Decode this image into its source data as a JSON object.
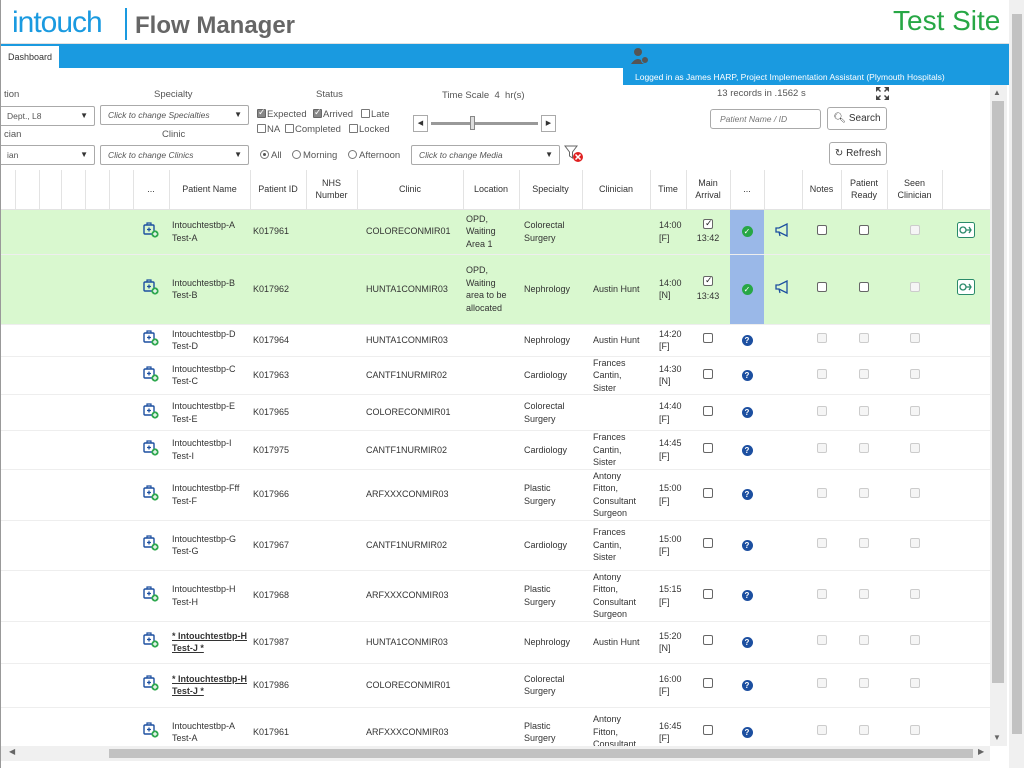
{
  "header": {
    "logo_intouch": "intouch",
    "logo_product": "Flow Manager",
    "site_label": "Test Site"
  },
  "nav": {
    "tab_dashboard": "Dashboard",
    "logged_in": "Logged in as James HARP, Project Implementation Assistant (Plymouth Hospitals)"
  },
  "filters": {
    "location_label": "tion",
    "location_value": "Dept., L8",
    "specialty_label": "Specialty",
    "specialty_placeholder": "Click to change Specialties",
    "clinician_label": "cian",
    "clinician_value": "ian",
    "clinic_label": "Clinic",
    "clinic_placeholder": "Click to change Clinics",
    "status_label": "Status",
    "status": {
      "expected": "Expected",
      "arrived": "Arrived",
      "late": "Late",
      "na": "NA",
      "completed": "Completed",
      "locked": "Locked"
    },
    "period": {
      "all": "All",
      "morning": "Morning",
      "afternoon": "Afternoon"
    },
    "timescale_label": "Time Scale",
    "timescale_value": "4",
    "timescale_unit": "hr(s)",
    "media_placeholder": "Click to change Media",
    "records_info": "13 records in .1562 s",
    "patient_placeholder": "Patient Name / ID",
    "search_label": "Search",
    "refresh_label": "Refresh"
  },
  "table": {
    "columns": {
      "dots1": "...",
      "patient_name": "Patient Name",
      "patient_id": "Patient ID",
      "nhs_number": "NHS Number",
      "clinic": "Clinic",
      "location": "Location",
      "specialty": "Specialty",
      "clinician": "Clinician",
      "time": "Time",
      "main_arrival": "Main Arrival",
      "dots2": "...",
      "notes": "Notes",
      "patient_ready": "Patient Ready",
      "seen_clinician": "Seen Clinician"
    },
    "rows": [
      {
        "name": "Intouchtestbp-A Test-A",
        "id": "K017961",
        "clinic": "COLORECONMIR01",
        "location": "OPD, Waiting Area 1",
        "specialty": "Colorectal Surgery",
        "clinician": "",
        "time": "14:00 [F]",
        "arrival_time": "13:42"
      },
      {
        "name": "Intouchtestbp-B Test-B",
        "id": "K017962",
        "clinic": "HUNTA1CONMIR03",
        "location": "OPD, Waiting area to be allocated",
        "specialty": "Nephrology",
        "clinician": "Austin Hunt",
        "time": "14:00 [N]",
        "arrival_time": "13:43"
      },
      {
        "name": "Intouchtestbp-D Test-D",
        "id": "K017964",
        "clinic": "HUNTA1CONMIR03",
        "location": "",
        "specialty": "Nephrology",
        "clinician": "Austin Hunt",
        "time": "14:20 [F]",
        "arrival_time": ""
      },
      {
        "name": "Intouchtestbp-C Test-C",
        "id": "K017963",
        "clinic": "CANTF1NURMIR02",
        "location": "",
        "specialty": "Cardiology",
        "clinician": "Frances Cantin, Sister",
        "time": "14:30 [N]",
        "arrival_time": ""
      },
      {
        "name": "Intouchtestbp-E Test-E",
        "id": "K017965",
        "clinic": "COLORECONMIR01",
        "location": "",
        "specialty": "Colorectal Surgery",
        "clinician": "",
        "time": "14:40 [F]",
        "arrival_time": ""
      },
      {
        "name": "Intouchtestbp-I Test-I",
        "id": "K017975",
        "clinic": "CANTF1NURMIR02",
        "location": "",
        "specialty": "Cardiology",
        "clinician": "Frances Cantin, Sister",
        "time": "14:45 [F]",
        "arrival_time": ""
      },
      {
        "name": "Intouchtestbp-Fff Test-F",
        "id": "K017966",
        "clinic": "ARFXXXCONMIR03",
        "location": "",
        "specialty": "Plastic Surgery",
        "clinician": "Antony Fitton, Consultant Surgeon",
        "time": "15:00 [F]",
        "arrival_time": ""
      },
      {
        "name": "Intouchtestbp-G Test-G",
        "id": "K017967",
        "clinic": "CANTF1NURMIR02",
        "location": "",
        "specialty": "Cardiology",
        "clinician": "Frances Cantin, Sister",
        "time": "15:00 [F]",
        "arrival_time": ""
      },
      {
        "name": "Intouchtestbp-H Test-H",
        "id": "K017968",
        "clinic": "ARFXXXCONMIR03",
        "location": "",
        "specialty": "Plastic Surgery",
        "clinician": "Antony Fitton, Consultant Surgeon",
        "time": "15:15 [F]",
        "arrival_time": ""
      },
      {
        "name": "* Intouchtestbp-H Test-J *",
        "id": "K017987",
        "clinic": "HUNTA1CONMIR03",
        "location": "",
        "specialty": "Nephrology",
        "clinician": "Austin Hunt",
        "time": "15:20 [N]",
        "arrival_time": ""
      },
      {
        "name": "* Intouchtestbp-H Test-J *",
        "id": "K017986",
        "clinic": "COLORECONMIR01",
        "location": "",
        "specialty": "Colorectal Surgery",
        "clinician": "",
        "time": "16:00 [F]",
        "arrival_time": ""
      },
      {
        "name": "Intouchtestbp-A Test-A",
        "id": "K017961",
        "clinic": "ARFXXXCONMIR03",
        "location": "",
        "specialty": "Plastic Surgery",
        "clinician": "Antony Fitton, Consultant",
        "time": "16:45 [F]",
        "arrival_time": ""
      }
    ]
  }
}
